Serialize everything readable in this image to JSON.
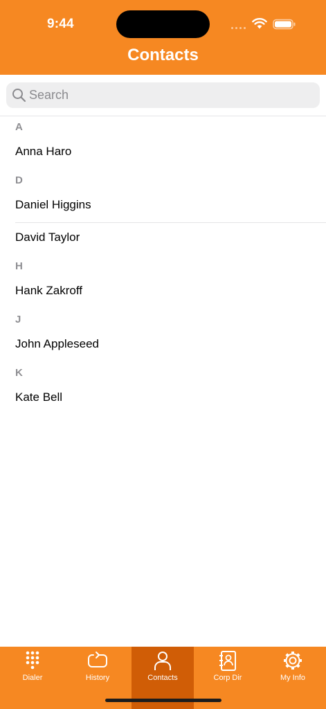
{
  "status_bar": {
    "time": "9:44"
  },
  "nav": {
    "title": "Contacts"
  },
  "search": {
    "placeholder": "Search",
    "value": ""
  },
  "sections": [
    {
      "letter": "A",
      "contacts": [
        "Anna Haro"
      ]
    },
    {
      "letter": "D",
      "contacts": [
        "Daniel Higgins",
        "David Taylor"
      ]
    },
    {
      "letter": "H",
      "contacts": [
        "Hank Zakroff"
      ]
    },
    {
      "letter": "J",
      "contacts": [
        "John Appleseed"
      ]
    },
    {
      "letter": "K",
      "contacts": [
        "Kate Bell"
      ]
    }
  ],
  "tabbar": {
    "active": "Contacts",
    "tabs": [
      {
        "label": "Dialer",
        "icon": "keypad-icon"
      },
      {
        "label": "History",
        "icon": "history-icon"
      },
      {
        "label": "Contacts",
        "icon": "person-icon"
      },
      {
        "label": "Corp Dir",
        "icon": "address-book-icon"
      },
      {
        "label": "My Info",
        "icon": "gear-icon"
      }
    ]
  },
  "colors": {
    "accent": "#f68822",
    "active_tab": "#d05d06",
    "section_text": "#8e8e92"
  }
}
